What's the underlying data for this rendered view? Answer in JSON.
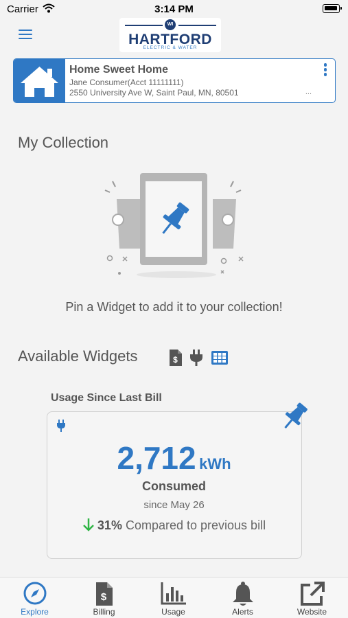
{
  "status_bar": {
    "carrier": "Carrier",
    "time": "3:14 PM"
  },
  "header": {
    "logo_badge": "WI",
    "logo_text": "HARTFORD",
    "logo_subtext": "ELECTRIC & WATER"
  },
  "account": {
    "name": "Home Sweet Home",
    "holder": "Jane Consumer(Acct 11111111)",
    "address": "2550 University Ave W, Saint Paul, MN, 80501",
    "ellipsis": "..."
  },
  "collection": {
    "title": "My Collection",
    "empty_message": "Pin a Widget to add it to your collection!"
  },
  "available_widgets": {
    "title": "Available Widgets",
    "filters": [
      "billing-icon",
      "plug-icon",
      "grid-icon"
    ]
  },
  "widget": {
    "caption": "Usage Since Last Bill",
    "value": "2,712",
    "unit": "kWh",
    "label": "Consumed",
    "since": "since May 26",
    "percent": "31%",
    "compare_text": "Compared to previous bill"
  },
  "tabs": [
    {
      "label": "Explore",
      "icon": "compass-icon",
      "active": true
    },
    {
      "label": "Billing",
      "icon": "billing-icon",
      "active": false
    },
    {
      "label": "Usage",
      "icon": "bar-chart-icon",
      "active": false
    },
    {
      "label": "Alerts",
      "icon": "bell-icon",
      "active": false
    },
    {
      "label": "Website",
      "icon": "external-link-icon",
      "active": false
    }
  ],
  "colors": {
    "accent": "#2f78c4",
    "brand_navy": "#1f3e74",
    "down_arrow": "#2fb545",
    "background": "#f3f3f3"
  }
}
